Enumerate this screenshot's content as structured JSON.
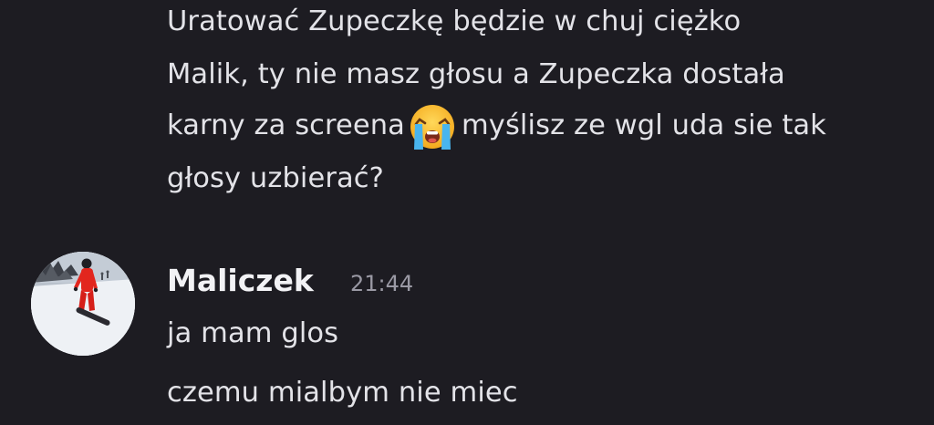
{
  "previous_message": {
    "lines": [
      "Uratować Zupeczkę będzie w chuj ciężko",
      "Malik, ty nie masz głosu a Zupeczka dostała",
      "karny za screena",
      "myślisz ze wgl uda sie tak",
      "głosy uzbierać?"
    ],
    "emoji": "loudly-crying-face-icon"
  },
  "message_group": {
    "author": "Maliczek",
    "timestamp": "21:44",
    "avatar": "user-avatar-snowboarder",
    "messages": [
      "ja mam glos",
      "czemu mialbym nie miec"
    ]
  },
  "colors": {
    "background": "#1d1c22",
    "text": "#e3e3e8",
    "timestamp": "#9a99a4"
  }
}
